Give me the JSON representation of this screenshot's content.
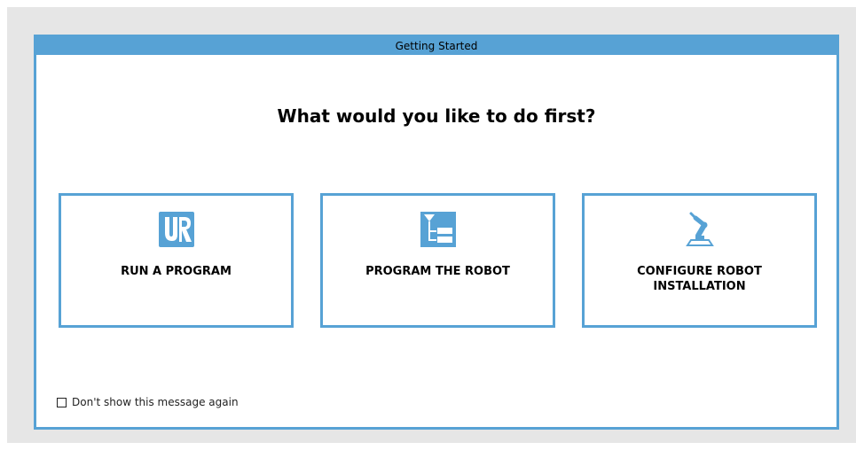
{
  "dialog": {
    "title": "Getting Started",
    "heading": "What would you like to do first?"
  },
  "options": [
    {
      "label": "RUN A PROGRAM",
      "icon": "ur-logo-icon"
    },
    {
      "label": "PROGRAM THE ROBOT",
      "icon": "program-tree-icon"
    },
    {
      "label": "CONFIGURE ROBOT INSTALLATION",
      "icon": "robot-arm-icon"
    }
  ],
  "dont_show": {
    "label": "Don't show this message again",
    "checked": false
  },
  "colors": {
    "accent": "#57a2d5",
    "backdrop": "#e6e6e6"
  }
}
